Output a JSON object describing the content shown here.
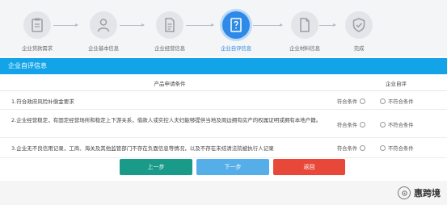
{
  "steps": [
    {
      "label": "企业贷款需求",
      "icon": "clipboard-icon"
    },
    {
      "label": "企业基本信息",
      "icon": "user-icon"
    },
    {
      "label": "企业经营信息",
      "icon": "document-icon"
    },
    {
      "label": "企业自评信息",
      "icon": "question-doc-icon",
      "active": true
    },
    {
      "label": "企业材料信息",
      "icon": "file-icon"
    },
    {
      "label": "完成",
      "icon": "shield-check-icon"
    }
  ],
  "section": {
    "title": "企业自评信息"
  },
  "table": {
    "header_condition": "产品申请条件",
    "header_self_eval": "企业自评",
    "rows": [
      {
        "text": "1.符合政府风险补偿金要求"
      },
      {
        "text": "2.企业经营稳定，有固定经营场所和稳定上下游关系，借款人或实控人夫妇能够提供当地及周边拥有房产的权属证明或拥有本地户籍。"
      },
      {
        "text": "3.企业无不良信用记录，工商、海关及其他监管部门不存在负面信息等情况，以及不存在未结清法院被执行人记录"
      }
    ],
    "option_yes": "符合条件",
    "option_no": "不符合条件"
  },
  "buttons": {
    "prev": "上一步",
    "next": "下一步",
    "back": "返回"
  },
  "watermark": {
    "text": "惠跨境"
  },
  "colors": {
    "accent": "#2e8ae6",
    "section_bar": "#12a3e8",
    "prev": "#1a9b8a",
    "next": "#56aee8",
    "back": "#e8483a"
  }
}
